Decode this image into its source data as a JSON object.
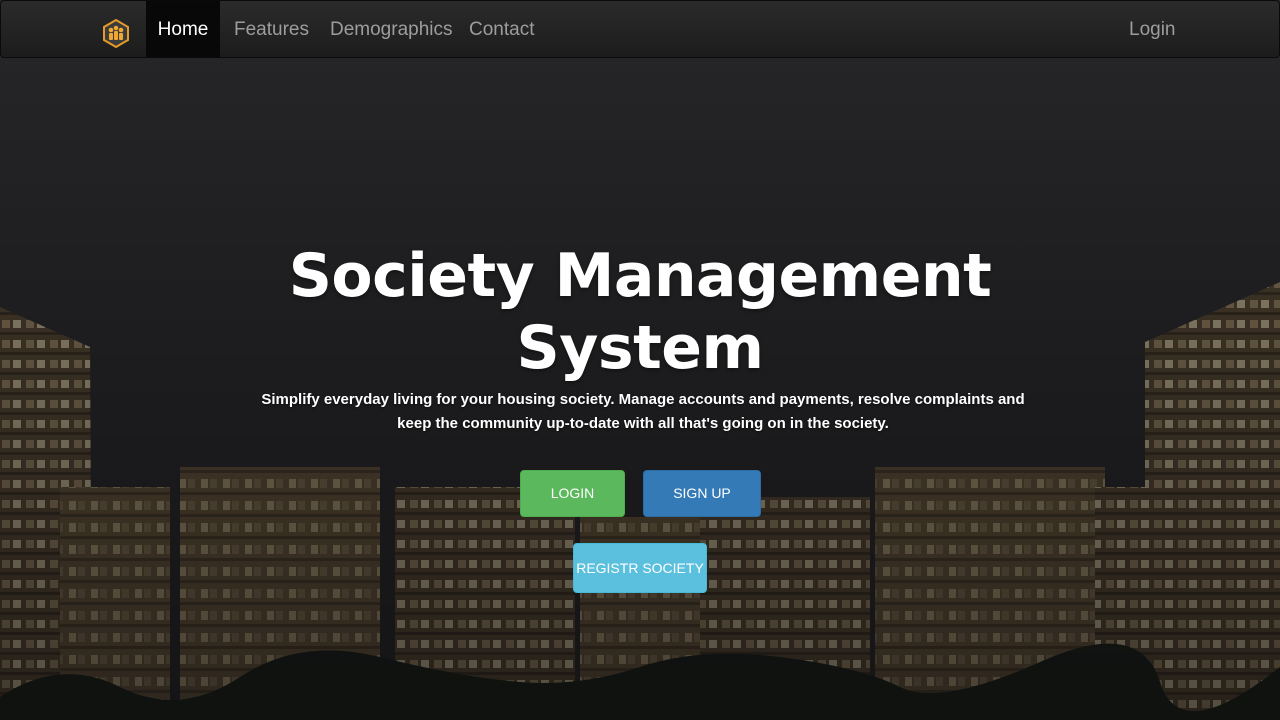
{
  "nav": {
    "brand_icon": "society-logo-icon",
    "items": [
      {
        "label": "Home",
        "active": true
      },
      {
        "label": "Features",
        "active": false
      },
      {
        "label": "Demographics",
        "active": false
      },
      {
        "label": "Contact",
        "active": false
      }
    ],
    "login_label": "Login"
  },
  "hero": {
    "title": "Society Management System",
    "subtitle": "Simplify everyday living for your housing society. Manage accounts and payments, resolve complaints and keep the community up-to-date with all that's going on in the society.",
    "buttons": {
      "login": "LOGIN",
      "signup": "SIGN UP",
      "register": "REGISTR SOCIETY"
    }
  },
  "colors": {
    "navbar": "#222222",
    "nav_active": "#080808",
    "login_button": "#5cb85c",
    "signup_button": "#337ab7",
    "register_button": "#5bc0de"
  }
}
